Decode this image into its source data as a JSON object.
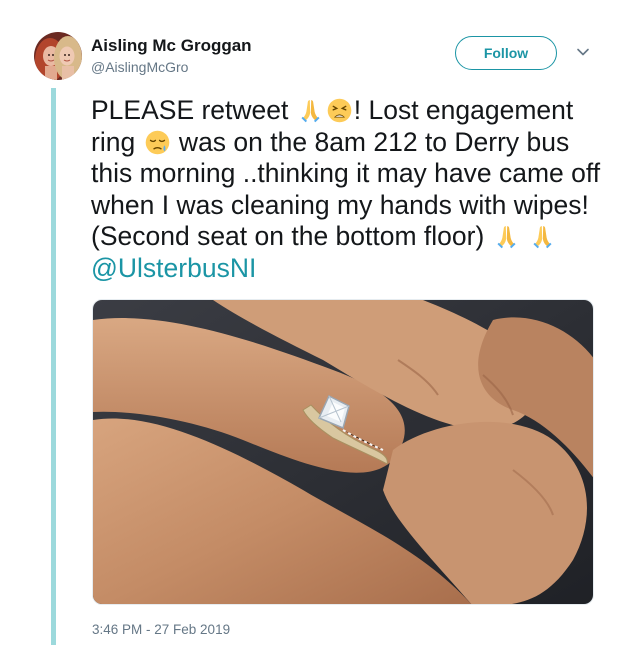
{
  "author": {
    "display_name": "Aisling Mc Groggan",
    "handle": "@AislingMcGro"
  },
  "follow_button": {
    "label": "Follow"
  },
  "tweet": {
    "seg1": "PLEASE retweet ",
    "seg2": "! Lost engagement ring ",
    "seg3": " was on the 8am 212 to Derry bus this morning ..thinking it may have came off when I was cleaning my hands with wipes! (Second seat on the bottom floor) ",
    "mention": "@UlsterbusNI",
    "emojis": [
      "folded-hands",
      "weary-face",
      "sleepy-face",
      "folded-hands",
      "folded-hands"
    ]
  },
  "photo": {
    "subject": "engagement-ring-on-hand"
  },
  "timestamp": "3:46 PM - 27 Feb 2019",
  "colors": {
    "accent": "#1b95a5",
    "thread": "#9cd9dc",
    "secondary_text": "#657786"
  },
  "icons": {
    "caret": "chevron-down-icon"
  }
}
